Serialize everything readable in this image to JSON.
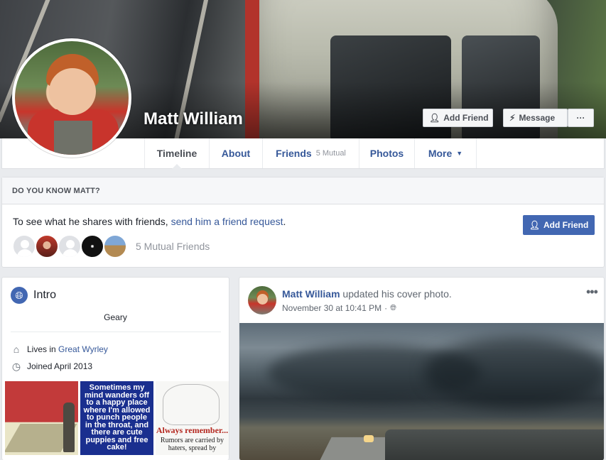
{
  "profile": {
    "name": "Matt William"
  },
  "cover_actions": {
    "add_friend_label": "Add Friend",
    "message_label": "Message",
    "more_label": "···",
    "add_friend_icon": "add-friend-icon",
    "message_icon": "messenger-icon"
  },
  "tabs": [
    {
      "label": "Timeline",
      "active": true
    },
    {
      "label": "About"
    },
    {
      "label": "Friends",
      "count": "5 Mutual"
    },
    {
      "label": "Photos"
    },
    {
      "label": "More",
      "caret": "▼"
    }
  ],
  "do_you_know": {
    "heading": "DO YOU KNOW MATT?",
    "text_prefix": "To see what he shares with friends, ",
    "link": "send him a friend request",
    "text_suffix": ".",
    "add_friend_label": "Add Friend",
    "mutual_friends_label": "5 Mutual Friends"
  },
  "intro": {
    "title": "Intro",
    "bio": "Geary",
    "lives_prefix": "Lives in ",
    "lives_link": "Great Wyrley",
    "joined": "Joined April 2013",
    "thumb2_text": "Sometimes my mind wanders off to a happy place where I'm allowed to punch people in the throat, and there are cute puppies and free cake!",
    "thumb3_title": "Always remember...",
    "thumb3_text": "Rumors are carried by haters, spread by"
  },
  "post": {
    "author": "Matt William",
    "action": " updated his cover photo.",
    "timestamp": "November 30 at 10:41 PM",
    "separator": "·",
    "menu_label": "•••"
  },
  "colors": {
    "link": "#365899",
    "primary_button": "#4267b2",
    "page_bg": "#e9ebee"
  }
}
